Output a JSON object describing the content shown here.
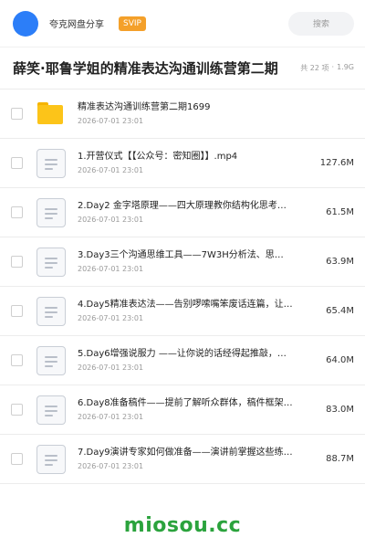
{
  "header": {
    "brand": "夸克网盘分享",
    "badge": "SVIP",
    "search_placeholder": "搜索"
  },
  "titlebar": {
    "title": "薛笑·耶鲁学姐的精准表达沟通训练营第二期",
    "count": "共 22 项",
    "separator": "·",
    "total_size": "1.9G"
  },
  "items": [
    {
      "type": "folder",
      "icon": "folder-icon",
      "name": "精准表达沟通训练营第二期1699",
      "date": "2026-07-01 23:01",
      "size": ""
    },
    {
      "type": "file",
      "icon": "document-icon",
      "name": "1.开营仪式【【公众号：密知圈】】.mp4",
      "date": "2026-07-01 23:01",
      "size": "127.6M"
    },
    {
      "type": "file",
      "icon": "document-icon",
      "name": "2.Day2 金字塔原理——四大原理教你结构化思考…",
      "date": "2026-07-01 23:01",
      "size": "61.5M"
    },
    {
      "type": "file",
      "icon": "document-icon",
      "name": "3.Day3三个沟通思维工具——7W3H分析法、思…",
      "date": "2026-07-01 23:01",
      "size": "63.9M"
    },
    {
      "type": "file",
      "icon": "document-icon",
      "name": "4.Day5精准表达法——告别啰嗦嘴笨废话连篇，让…",
      "date": "2026-07-01 23:01",
      "size": "65.4M"
    },
    {
      "type": "file",
      "icon": "document-icon",
      "name": "5.Day6增强说服力 ——让你说的话经得起推敲，…",
      "date": "2026-07-01 23:01",
      "size": "64.0M"
    },
    {
      "type": "file",
      "icon": "document-icon",
      "name": "6.Day8准备稿件——提前了解听众群体，稿件框架…",
      "date": "2026-07-01 23:01",
      "size": "83.0M"
    },
    {
      "type": "file",
      "icon": "document-icon",
      "name": "7.Day9演讲专家如何做准备——演讲前掌握这些练…",
      "date": "2026-07-01 23:01",
      "size": "88.7M"
    }
  ],
  "watermark": "miosou.cc",
  "colors": {
    "accent": "#2c7ef8",
    "badge": "#f4a02a",
    "watermark": "#2ba33d"
  }
}
